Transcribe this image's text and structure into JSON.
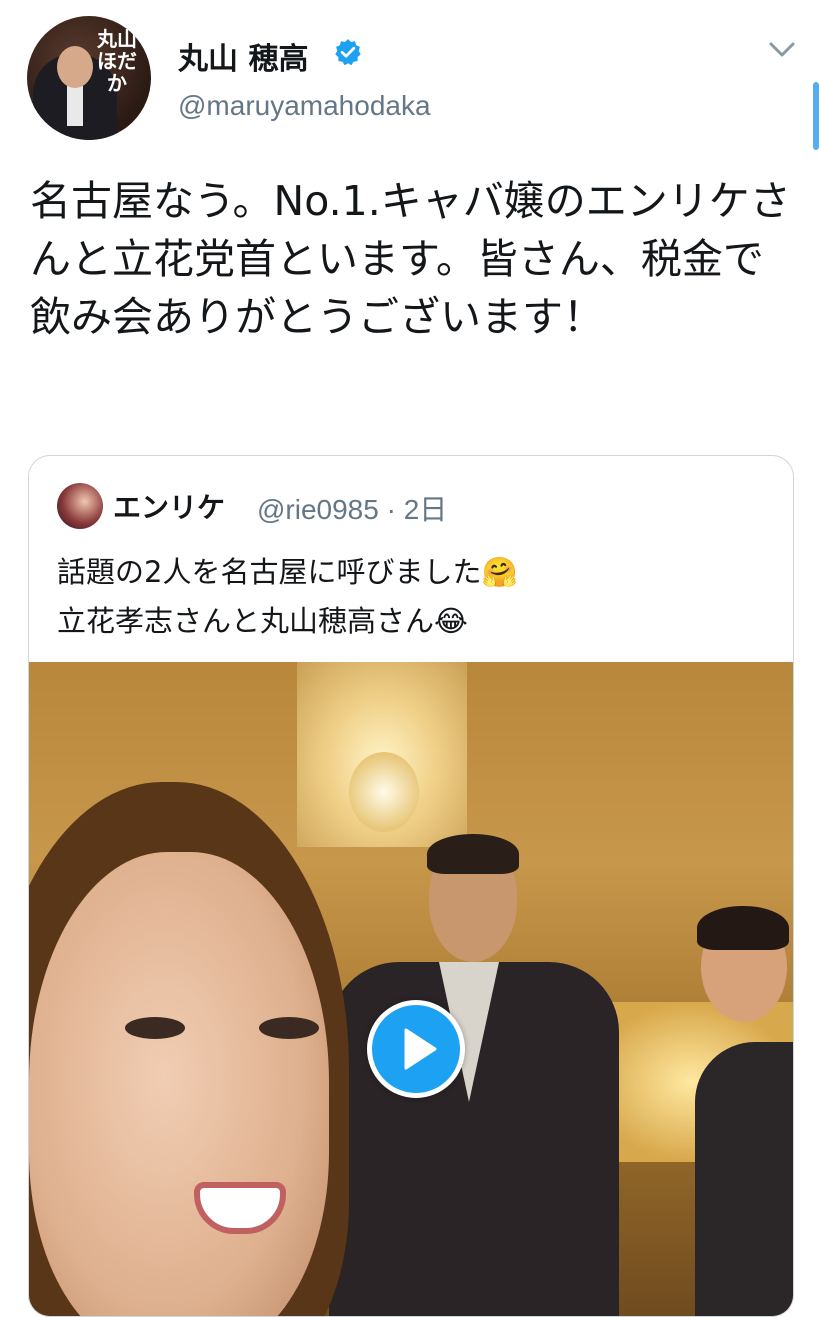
{
  "author": {
    "display_name": "丸山 穂高",
    "handle": "@maruyamahodaka",
    "avatar_text": "丸山ほだか",
    "verified": true
  },
  "tweet": {
    "text": "名古屋なう。No.1.キャバ嬢のエンリケさんと立花党首といます。皆さん、税金で飲み会ありがとうございます！"
  },
  "quoted_tweet": {
    "display_name": "エンリケ",
    "handle_time": "@rie0985 · 2日",
    "line1": "話題の2人を名古屋に呼びました🤗",
    "line2": "立花孝志さんと丸山穂高さん😂"
  },
  "media": {
    "type": "video",
    "play_icon": "play-icon"
  },
  "colors": {
    "accent": "#1da1f2",
    "secondary_text": "#657786",
    "border": "#ccd6dd"
  }
}
